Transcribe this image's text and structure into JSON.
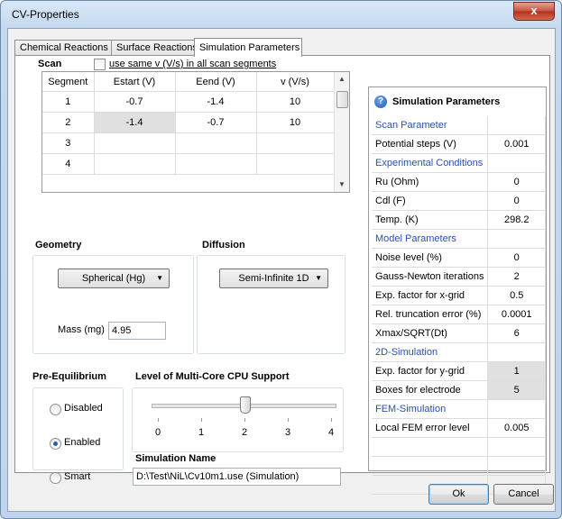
{
  "window": {
    "title": "CV-Properties",
    "close_glyph": "x"
  },
  "tabs": [
    {
      "label": "Chemical Reactions"
    },
    {
      "label": "Surface Reactions"
    },
    {
      "label": "Simulation Parameters"
    }
  ],
  "scan": {
    "title": "Scan",
    "same_v_label": "use same  v (V/s)  in all scan segments",
    "same_v_checked": false,
    "columns": [
      "Segment",
      "Estart (V)",
      "Eend (V)",
      "v (V/s)"
    ],
    "rows": [
      [
        "1",
        "-0.7",
        "-1.4",
        "10"
      ],
      [
        "2",
        "-1.4",
        "-0.7",
        "10"
      ],
      [
        "3",
        "",
        "",
        ""
      ],
      [
        "4",
        "",
        "",
        ""
      ]
    ]
  },
  "geometry": {
    "title": "Geometry",
    "selected": "Spherical (Hg)",
    "mass_label": "Mass (mg)",
    "mass_value": "4.95"
  },
  "diffusion": {
    "title": "Diffusion",
    "selected": "Semi-Infinite 1D"
  },
  "pre_equilibrium": {
    "title": "Pre-Equilibrium",
    "options": [
      "Disabled",
      "Enabled",
      "Smart"
    ],
    "selected": "Enabled"
  },
  "multicore": {
    "title": "Level of Multi-Core CPU Support",
    "ticks": [
      "0",
      "1",
      "2",
      "3",
      "4"
    ],
    "value": 2
  },
  "simulation_name": {
    "title": "Simulation Name",
    "value": "D:\\Test\\NiL\\Cv10m1.use (Simulation)"
  },
  "sim_params": {
    "title": "Simulation Parameters",
    "rows": [
      {
        "label": "Scan Parameter",
        "value": "",
        "header": true
      },
      {
        "label": "Potential steps (V)",
        "value": "0.001"
      },
      {
        "label": "Experimental Conditions",
        "value": "",
        "header": true
      },
      {
        "label": "Ru (Ohm)",
        "value": "0"
      },
      {
        "label": "Cdl (F)",
        "value": "0"
      },
      {
        "label": "Temp. (K)",
        "value": "298.2"
      },
      {
        "label": "Model Parameters",
        "value": "",
        "header": true
      },
      {
        "label": "Noise level (%)",
        "value": "0"
      },
      {
        "label": "Gauss-Newton iterations",
        "value": "2"
      },
      {
        "label": "Exp. factor for x-grid",
        "value": "0.5"
      },
      {
        "label": "Rel. truncation error (%)",
        "value": "0.0001"
      },
      {
        "label": "Xmax/SQRT(Dt)",
        "value": "6"
      },
      {
        "label": "2D-Simulation",
        "value": "",
        "header": true
      },
      {
        "label": "Exp. factor for y-grid",
        "value": "1",
        "shaded": true
      },
      {
        "label": "Boxes for electrode",
        "value": "5",
        "shaded": true
      },
      {
        "label": "FEM-Simulation",
        "value": "",
        "header": true
      },
      {
        "label": "Local FEM error level",
        "value": "0.005"
      },
      {
        "label": "",
        "value": ""
      },
      {
        "label": "",
        "value": ""
      },
      {
        "label": "",
        "value": ""
      }
    ]
  },
  "buttons": {
    "ok": "Ok",
    "cancel": "Cancel"
  },
  "colors": {
    "accent": "#2a50b0",
    "selected_cell": "#e0e0e0",
    "title_gradient": "#c4d8ee"
  }
}
